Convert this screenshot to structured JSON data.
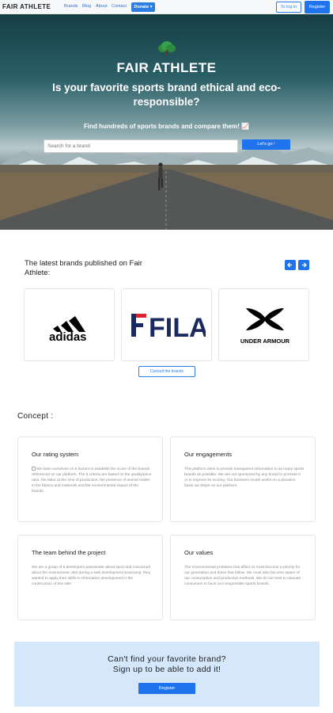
{
  "nav": {
    "brand": "FAIR ATHLETE",
    "links": [
      "Brands",
      "Blog",
      "About",
      "Contact"
    ],
    "donate": "Donate ▾",
    "login": "To log in",
    "register": "Register"
  },
  "hero": {
    "title": "FAIR ATHLETE",
    "subtitle": "Is your favorite sports brand ethical and eco-responsible?",
    "small": "Find hundreds of sports brands and compare them! 📈",
    "search_placeholder": "Search for a brand",
    "go": "Let's go !"
  },
  "latest": {
    "title": "The latest brands published on Fair Athlete:",
    "brands": [
      "adidas",
      "FILA",
      "UNDER ARMOUR"
    ],
    "consult": "Consult the brands"
  },
  "concept": {
    "title": "Concept :",
    "cards": [
      {
        "title": "Our rating system",
        "text": "We base ourselves on 5 factors to establish the score of the brands referenced on our platform. The 5 criteria are based on the quality/price ratio, the labor at the time of production, the presence of animal matter in the fabrics and materials and the environmental impact of the brands."
      },
      {
        "title": "Our engagements",
        "text": "This platform aims to provide transparent information to as many sports brands as possible. We are not sponsored by any brand to promote it or to improve its scoring. Our business model works on a donation basis via Stripe on our platform."
      },
      {
        "title": "The team behind the project",
        "text": "We are a group of 5 developers passionate about sport and concerned about the environment. Met during a web development bootcamp, they wanted to apply their skills in information development in the construction of this site!"
      },
      {
        "title": "Our values",
        "text": "The environmental problems that affect us must become a priority for our generation and those that follow. We must also become aware of our consumption and production methods. We do our best to educate consumers to favor eco-responsible sports brands."
      }
    ]
  },
  "cta": {
    "line1": "Can't find your favorite brand?",
    "line2": "Sign up to be able to add it!",
    "button": "Register"
  },
  "colors": {
    "accent": "#1f74ee",
    "cta_bg": "#d4e7fb",
    "tree": "#2e8b3e"
  }
}
